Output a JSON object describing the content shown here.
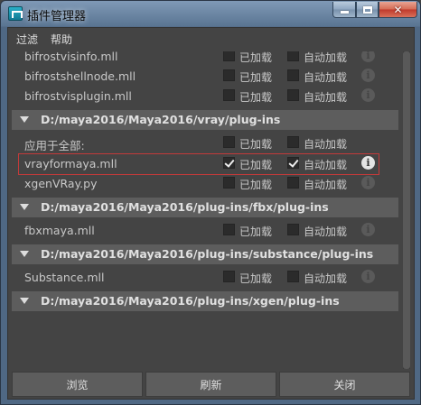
{
  "window": {
    "title": "插件管理器",
    "icon": "maya-icon",
    "close_glyph": "✕"
  },
  "menu": [
    "过滤",
    "帮助"
  ],
  "labels": {
    "loaded": "已加载",
    "autoload": "自动加载",
    "info": "i"
  },
  "rows": [
    {
      "type": "plugin",
      "name": "bifrostvisinfo.mll",
      "loaded": false,
      "autoload": false,
      "info": false,
      "partial": true
    },
    {
      "type": "plugin",
      "name": "bifrostshellnode.mll",
      "loaded": false,
      "autoload": false,
      "info": false
    },
    {
      "type": "plugin",
      "name": "bifrostvisplugin.mll",
      "loaded": false,
      "autoload": false,
      "info": false
    },
    {
      "type": "section",
      "path": "D:/maya2016/Maya2016/vray/plug-ins"
    },
    {
      "type": "apply_all",
      "name": "应用于全部:",
      "loaded": false,
      "autoload": false
    },
    {
      "type": "plugin",
      "name": "vrayformaya.mll",
      "loaded": true,
      "autoload": true,
      "info": true,
      "highlight": true
    },
    {
      "type": "plugin",
      "name": "xgenVRay.py",
      "loaded": false,
      "autoload": false,
      "info": false
    },
    {
      "type": "section",
      "path": "D:/maya2016/Maya2016/plug-ins/fbx/plug-ins"
    },
    {
      "type": "plugin",
      "name": "fbxmaya.mll",
      "loaded": false,
      "autoload": false,
      "info": false
    },
    {
      "type": "section",
      "path": "D:/maya2016/Maya2016/plug-ins/substance/plug-ins"
    },
    {
      "type": "plugin",
      "name": "Substance.mll",
      "loaded": false,
      "autoload": false,
      "info": false
    },
    {
      "type": "section",
      "path": "D:/maya2016/Maya2016/plug-ins/xgen/plug-ins"
    }
  ],
  "buttons": {
    "browse": "浏览",
    "refresh": "刷新",
    "close": "关闭"
  },
  "colors": {
    "highlight_border": "#c33a3a",
    "section_bg": "#5d5d5d",
    "panel_bg": "#444444"
  }
}
